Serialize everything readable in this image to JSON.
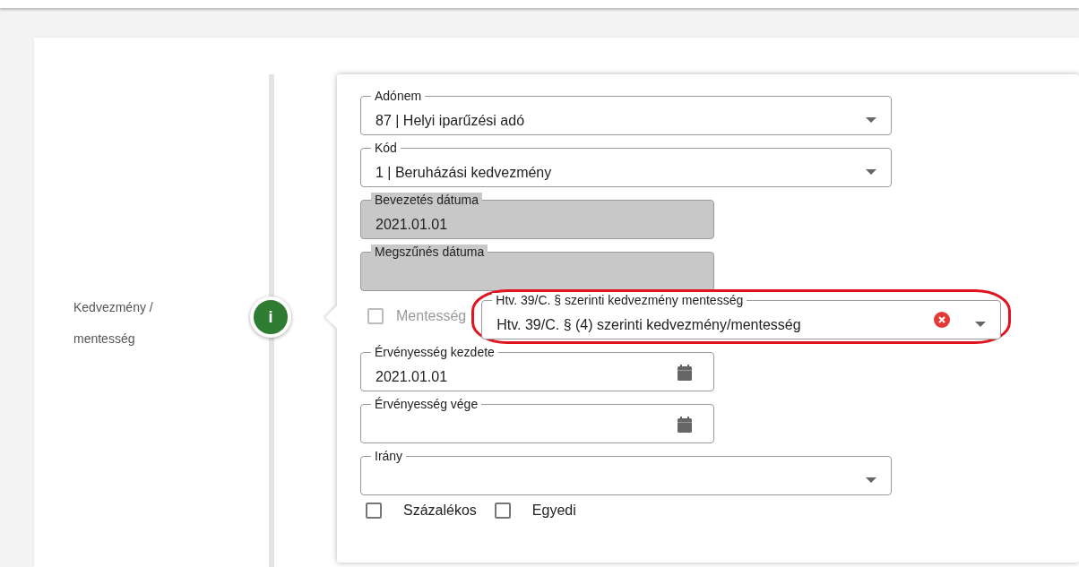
{
  "section_label": "Kedvezmény / mentesség",
  "info_badge": "i",
  "fields": [
    {
      "kind": "select",
      "label": "Adónem",
      "value": "87 | Helyi iparűzési adó",
      "disabled": false
    },
    {
      "kind": "select",
      "label": "Kód",
      "value": "1 | Beruházási kedvezmény",
      "disabled": false
    },
    {
      "kind": "text",
      "label": "Bevezetés dátuma",
      "value": "2021.01.01",
      "disabled": true
    },
    {
      "kind": "text",
      "label": "Megszűnés dátuma",
      "disabled": true
    },
    {
      "kind": "exemption",
      "checkbox": {
        "label": "Mentesség",
        "checked": false,
        "disabled": true
      },
      "label": "Htv. 39/C. § szerinti kedvezmény mentesség",
      "value": "Htv. 39/C. § (4) szerinti kedvezmény/mentesség",
      "highlighted": true
    },
    {
      "kind": "date",
      "label": "Érvényesség kezdete",
      "value": "2021.01.01",
      "disabled": false
    },
    {
      "kind": "date",
      "label": "Érvényesség vége",
      "disabled": false
    },
    {
      "kind": "select",
      "label": "Irány",
      "disabled": false
    },
    {
      "kind": "checkboxes",
      "items": [
        {
          "label": "Százalékos",
          "checked": false
        },
        {
          "label": "Egyedi",
          "checked": false
        }
      ]
    }
  ]
}
